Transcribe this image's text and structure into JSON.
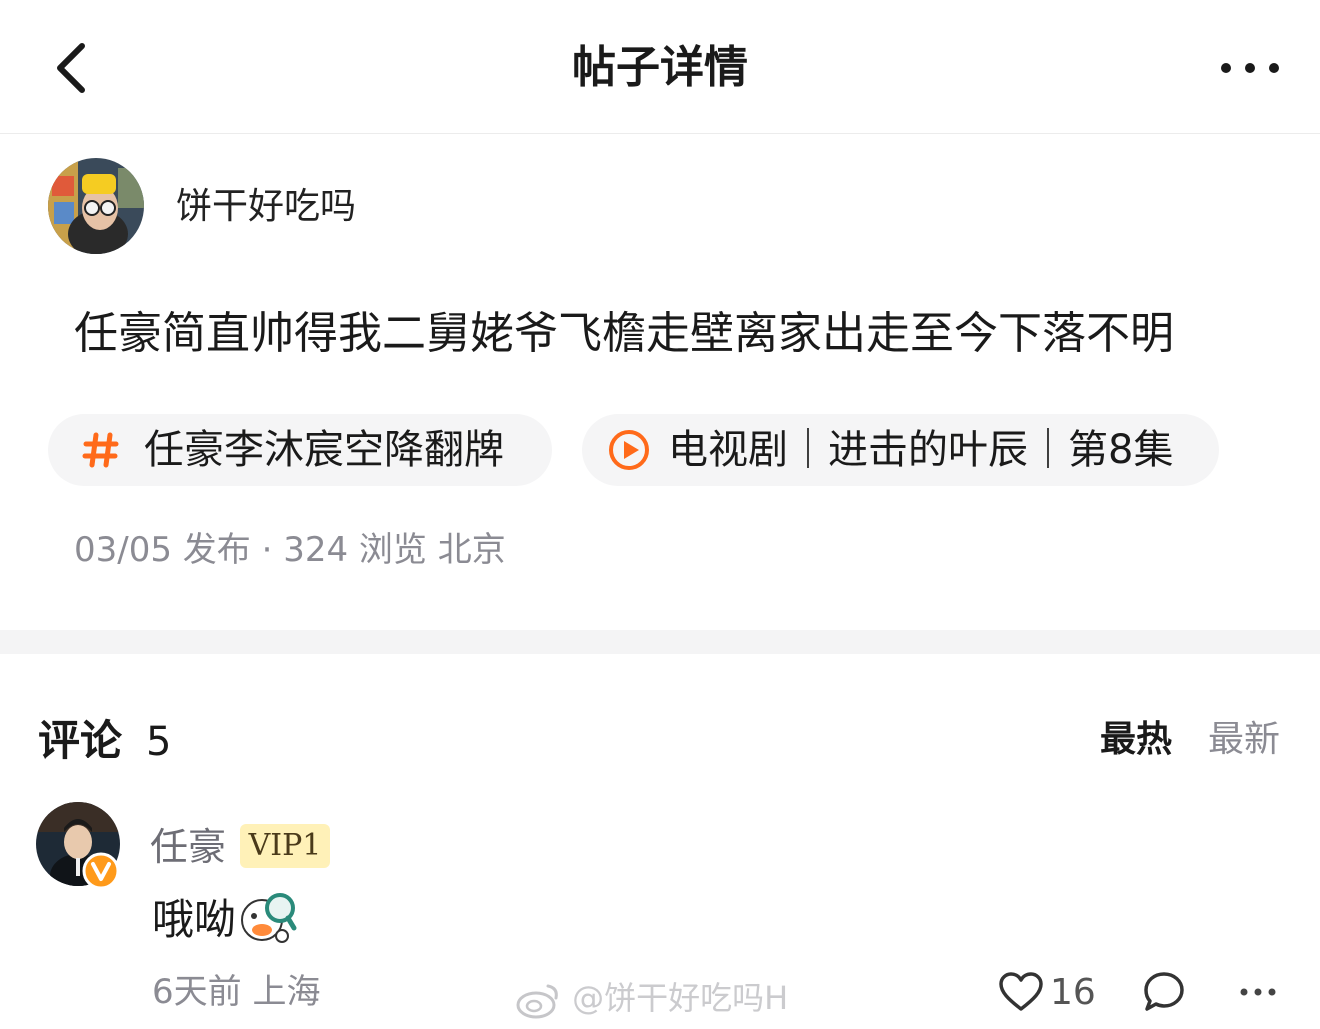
{
  "nav": {
    "title": "帖子详情"
  },
  "post": {
    "author_name": "饼干好吃吗",
    "text": "任豪简直帅得我二舅姥爷飞檐走壁离家出走至今下落不明",
    "topic_chip": "任豪李沐宸空降翻牌",
    "video_chip": "电视剧｜进击的叶辰｜第8集",
    "meta": "03/05 发布 · 324 浏览  北京",
    "accent_color": "#ff6a1a"
  },
  "comments": {
    "title": "评论",
    "count": "5",
    "sort_hot": "最热",
    "sort_new": "最新",
    "items": [
      {
        "name": "任豪",
        "vip": "VIP1",
        "text": "哦呦",
        "time": "6天前 上海",
        "likes": "16"
      }
    ]
  },
  "watermark": "@饼干好吃吗H"
}
